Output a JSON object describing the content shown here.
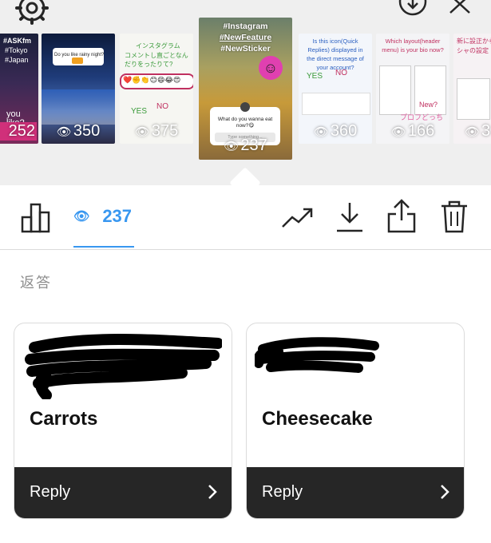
{
  "stories": [
    {
      "views": "252",
      "captions": [
        "#ASKfm",
        "#Tokyo",
        "#Japan",
        "you like?"
      ]
    },
    {
      "views": "350",
      "captions": [
        "Do you like rainy night?"
      ]
    },
    {
      "views": "375",
      "captions": [
        "コメントし直ごとなんだりをったりて?",
        "インスタグラム",
        "YES",
        "NO"
      ]
    },
    {
      "views": "237",
      "captions": [
        "#Instagram",
        "#NewFeature",
        "#NewSticker"
      ],
      "question": "What do you wanna eat now?😋",
      "question_placeholder": "Type something..."
    },
    {
      "views": "360",
      "captions": [
        "Is this icon(Quick Replies) displayed in the direct message of your account?",
        "YES",
        "NO"
      ]
    },
    {
      "views": "166",
      "captions": [
        "Which layout(header menu) is your bio now?",
        "New?",
        "プロフどっち"
      ]
    },
    {
      "views": "3",
      "captions": [
        "新に設正から",
        "シャの設定"
      ]
    }
  ],
  "action_bar": {
    "viewers_count": "237"
  },
  "section_label": "返答",
  "replies": [
    {
      "answer": "Carrots",
      "button_label": "Reply"
    },
    {
      "answer": "Cheesecake",
      "button_label": "Reply"
    }
  ],
  "colors": {
    "accent": "#3897f0",
    "reply_bar": "#262626",
    "strip_bg": "#efefef"
  }
}
